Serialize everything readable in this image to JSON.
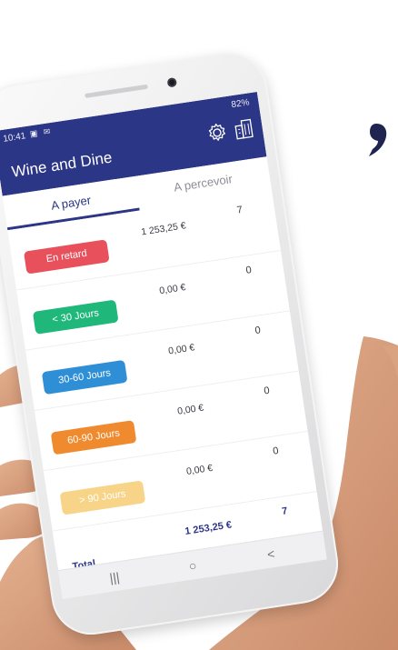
{
  "status_bar": {
    "time": "10:41",
    "left_icons": "▣ ✉",
    "right_text": "82%"
  },
  "header": {
    "title": "Wine and Dine",
    "settings_icon": "gear-icon",
    "building_icon": "building-icon",
    "color": "#2c3686"
  },
  "tabs": [
    {
      "label": "A payer",
      "active": true
    },
    {
      "label": "A percevoir",
      "active": false
    }
  ],
  "rows": [
    {
      "badge": "En retard",
      "color": "#e8505b",
      "amount": "1 253,25 €",
      "count": "7"
    },
    {
      "badge": "< 30 Jours",
      "color": "#1fb77a",
      "amount": "0,00 €",
      "count": "0"
    },
    {
      "badge": "30-60 Jours",
      "color": "#2f8fd6",
      "amount": "0,00 €",
      "count": "0"
    },
    {
      "badge": "60-90 Jours",
      "color": "#f08a2e",
      "amount": "0,00 €",
      "count": "0"
    },
    {
      "badge": "> 90 Jours",
      "color": "#f7d488",
      "amount": "0,00 €",
      "count": "0"
    }
  ],
  "total": {
    "label": "Total",
    "amount": "1 253,25 €",
    "count": "7"
  },
  "navbar": {
    "recent": "|||",
    "home": "○",
    "back": "<"
  }
}
